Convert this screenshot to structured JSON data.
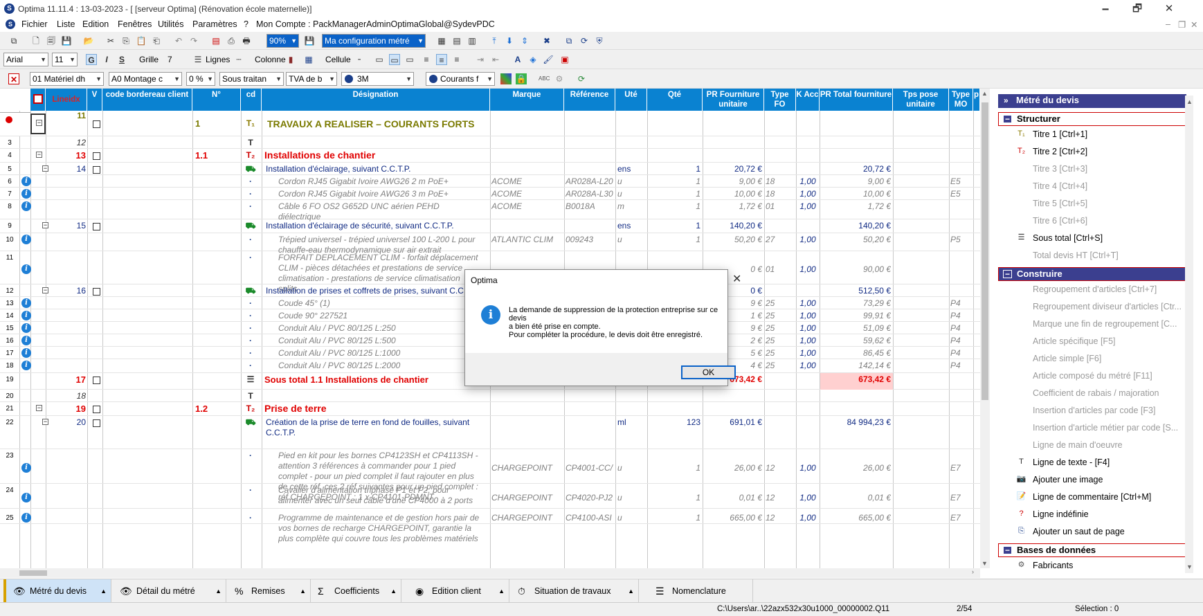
{
  "app": {
    "title": "Optima 11.11.4 : 13-03-2023 - [ [serveur Optima] (Rénovation école maternelle)]",
    "min": "🗕",
    "restore": "🗗",
    "close": "✕"
  },
  "menu": [
    "Fichier",
    "Liste",
    "Edition",
    "Fenêtres",
    "Utilités",
    "Paramètres",
    "?",
    "Mon Compte : PackManagerAdminOptimaGlobal@SydevPDC"
  ],
  "toolbar1": {
    "zoom": "90%",
    "config": "Ma configuration métré"
  },
  "toolbar2": {
    "font": "Arial",
    "size": "11",
    "bold": "G",
    "italic": "I",
    "strike": "S",
    "grille_label": "Grille",
    "grille_val": "7",
    "lignes_label": "Lignes",
    "colonne_label": "Colonne",
    "cellule_label": "Cellule"
  },
  "toolbar3": {
    "materiel": "01  Matériel dh",
    "montage": "A0  Montage c",
    "pct": "0 %",
    "sous_traitance": "Sous traitan",
    "tva": "TVA de b",
    "marque": "3M",
    "courants": "Courants f"
  },
  "columns": [
    "Lineidx",
    "V",
    "code bordereau client",
    "N°",
    "cd",
    "Désignation",
    "Marque",
    "Référence",
    "Uté",
    "Qté",
    "PR Fourniture unitaire",
    "Type FO",
    "K Acc",
    "PR Total fourniture",
    "Tps pose unitaire",
    "Type MO",
    "p"
  ],
  "rows": [
    {
      "n": "",
      "idx": "11",
      "num": "1",
      "des": "TRAVAUX A REALISER – COURANTS FORTS",
      "kind": "t1"
    },
    {
      "n": "3",
      "idx": "12",
      "kind": "text"
    },
    {
      "n": "4",
      "idx": "13",
      "num": "1.1",
      "des": "Installations de chantier",
      "kind": "t2"
    },
    {
      "n": "5",
      "idx": "14",
      "des": "Installation d'éclairage, suivant C.C.T.P.",
      "ute": "ens",
      "qte": "1",
      "pru": "20,72 €",
      "prt": "20,72 €",
      "kind": "comp"
    },
    {
      "n": "6",
      "des": "Cordon RJ45 Gigabit Ivoire AWG26 2 m PoE+",
      "marque": "ACOME",
      "ref": "AR028A-L20",
      "ute": "u",
      "qte": "1",
      "pru": "9,00 €",
      "fo": "18",
      "k": "1,00",
      "prt": "9,00 €",
      "mo": "E5",
      "kind": "art"
    },
    {
      "n": "7",
      "des": "Cordon RJ45 Gigabit Ivoire AWG26 3 m PoE+",
      "marque": "ACOME",
      "ref": "AR028A-L30",
      "ute": "u",
      "qte": "1",
      "pru": "10,00 €",
      "fo": "18",
      "k": "1,00",
      "prt": "10,00 €",
      "mo": "E5",
      "kind": "art"
    },
    {
      "n": "8",
      "des": "Câble 6 FO OS2 G652D UNC aérien PEHD",
      "des2": "diélectrique",
      "marque": "ACOME",
      "ref": "B0018A",
      "ute": "m",
      "qte": "1",
      "pru": "1,72 €",
      "fo": "01",
      "k": "1,00",
      "prt": "1,72 €",
      "kind": "art"
    },
    {
      "n": "9",
      "idx": "15",
      "des": "Installation d'éclairage de sécurité, suivant C.C.T.P.",
      "ute": "ens",
      "qte": "1",
      "pru": "140,20 €",
      "prt": "140,20 €",
      "kind": "comp"
    },
    {
      "n": "10",
      "des": "Trépied universel - trépied universel 100 L-200 L pour",
      "des2": "chauffe-eau thermodynamique sur air extrait",
      "marque": "ATLANTIC CLIM",
      "ref": "009243",
      "ute": "u",
      "qte": "1",
      "pru": "50,20 €",
      "fo": "27",
      "k": "1,00",
      "prt": "50,20 €",
      "mo": "P5",
      "kind": "art"
    },
    {
      "n": "11",
      "des": "FORFAIT DEPLACEMENT CLIM - forfait déplacement",
      "des2": "CLIM - pièces détachées et prestations de service",
      "des3": "climatisation - prestations de service climatisation",
      "des4": "splits",
      "pru": "0 €",
      "fo": "01",
      "k": "1,00",
      "prt": "90,00 €",
      "kind": "art"
    },
    {
      "n": "12",
      "idx": "16",
      "des": "Installation de prises et coffrets de prises, suivant C.C",
      "pru": "0 €",
      "prt": "512,50 €",
      "kind": "comp"
    },
    {
      "n": "13",
      "des": "Coude 45° (1)",
      "pru": "9 €",
      "fo": "25",
      "k": "1,00",
      "prt": "73,29 €",
      "mo": "P4",
      "kind": "art"
    },
    {
      "n": "14",
      "des": "Coude 90° 227521",
      "pru": "1 €",
      "fo": "25",
      "k": "1,00",
      "prt": "99,91 €",
      "mo": "P4",
      "kind": "art"
    },
    {
      "n": "15",
      "des": "Conduit Alu / PVC 80/125 L:250",
      "pru": "9 €",
      "fo": "25",
      "k": "1,00",
      "prt": "51,09 €",
      "mo": "P4",
      "kind": "art"
    },
    {
      "n": "16",
      "des": "Conduit Alu / PVC 80/125 L:500",
      "pru": "2 €",
      "fo": "25",
      "k": "1,00",
      "prt": "59,62 €",
      "mo": "P4",
      "kind": "art"
    },
    {
      "n": "17",
      "des": "Conduit Alu / PVC 80/125 L:1000",
      "pru": "5 €",
      "fo": "25",
      "k": "1,00",
      "prt": "86,45 €",
      "mo": "P4",
      "kind": "art"
    },
    {
      "n": "18",
      "des": "Conduit Alu / PVC 80/125 L:2000",
      "pru": "4 €",
      "fo": "25",
      "k": "1,00",
      "prt": "142,14 €",
      "mo": "P4",
      "kind": "art"
    },
    {
      "n": "19",
      "idx": "17",
      "des": "Sous total 1.1 Installations de chantier",
      "pru": "673,42 €",
      "prt": "673,42 €",
      "kind": "st"
    },
    {
      "n": "20",
      "idx": "18",
      "kind": "text"
    },
    {
      "n": "21",
      "idx": "19",
      "num": "1.2",
      "des": "Prise de terre",
      "kind": "t2"
    },
    {
      "n": "22",
      "idx": "20",
      "des": "Création de la prise de terre en fond de fouilles, suivant",
      "des2": "C.C.T.P.",
      "ute": "ml",
      "qte": "123",
      "pru": "691,01 €",
      "prt": "84 994,23 €",
      "kind": "comp"
    },
    {
      "n": "23",
      "des": "Pied en kit pour les bornes CP4123SH et CP4113SH -",
      "des2": "attention 3 références à commander pour 1 pied",
      "des3": "complet - pour un pied complet il faut rajouter en plus",
      "des4": "de cette réf, ces 2 réf suivantes pour un pied complet :",
      "des5": "réf CHARGEPOINT : 1 x CP4101-PDMNT",
      "marque": "CHARGEPOINT",
      "ref": "CP4001-CC/",
      "ute": "u",
      "qte": "1",
      "pru": "26,00 €",
      "fo": "12",
      "k": "1,00",
      "prt": "26,00 €",
      "mo": "E7",
      "kind": "art"
    },
    {
      "n": "24",
      "des": "Cavalier d'alimentation triphasé P1 et P2, pour",
      "des2": "alimenter avec un seul câble d'une CP4000 à 2 ports",
      "marque": "CHARGEPOINT",
      "ref": "CP4020-PJ2",
      "ute": "u",
      "qte": "1",
      "pru": "0,01 €",
      "fo": "12",
      "k": "1,00",
      "prt": "0,01 €",
      "mo": "E7",
      "kind": "art"
    },
    {
      "n": "25",
      "des": "Programme de maintenance et de gestion hors pair de",
      "des2": "vos bornes de recharge CHARGEPOINT, garantie la",
      "des3": "plus complète qui couvre tous les problèmes matériels",
      "marque": "CHARGEPOINT",
      "ref": "CP4100-ASI",
      "ute": "u",
      "qte": "1",
      "pru": "665,00 €",
      "fo": "12",
      "k": "1,00",
      "prt": "665,00 €",
      "mo": "E7",
      "kind": "art"
    }
  ],
  "panel": {
    "title": "Métré du devis",
    "structurer": "Structurer",
    "structurer_items": [
      "Titre 1 [Ctrl+1]",
      "Titre 2 [Ctrl+2]",
      "Titre 3 [Ctrl+3]",
      "Titre 4 [Ctrl+4]",
      "Titre 5 [Ctrl+5]",
      "Titre 6 [Ctrl+6]",
      "Sous total [Ctrl+S]",
      "Total devis HT [Ctrl+T]"
    ],
    "construire": "Construire",
    "construire_items": [
      "Regroupement d'articles  [Ctrl+7]",
      "Regroupement diviseur d'articles [Ctr...",
      "Marque une fin de regroupement  [C...",
      "Article spécifique [F5]",
      "Article simple [F6]",
      "Article composé du métré [F11]",
      "Coefficient de rabais / majoration",
      "Insertion d'articles par code [F3]",
      "Insertion d'article métier par code [S...",
      "Ligne de main d'oeuvre",
      "Ligne de texte - [F4]",
      "Ajouter une image",
      "Ligne de commentaire [Ctrl+M]",
      "Ligne indéfinie",
      "Ajouter un saut de page"
    ],
    "bases": "Bases de données",
    "bases_items": [
      "Fabricants"
    ]
  },
  "bottom_tabs": [
    "Métré du devis",
    "Détail du métré",
    "Remises",
    "Coefficients",
    "Edition client",
    "Situation de travaux",
    "Nomenclature"
  ],
  "status": {
    "path": "C:\\Users\\ar..\\22azx532x30u1000_00000002.Q11",
    "page": "2/54",
    "selection": "Sélection : 0"
  },
  "dialog": {
    "title": "Optima",
    "line1": "La demande de suppression de la protection entreprise sur ce",
    "line2": "devis",
    "line3": "a bien été prise en compte.",
    "line4": "Pour compléter la procédure, le devis doit être enregistré.",
    "ok": "OK",
    "close": "✕"
  },
  "colors": {
    "header_blue": "#0a82d1",
    "title_red": "#e00000",
    "navy": "#102a83",
    "panel_head": "#3b3f8f",
    "olive": "#808000"
  }
}
